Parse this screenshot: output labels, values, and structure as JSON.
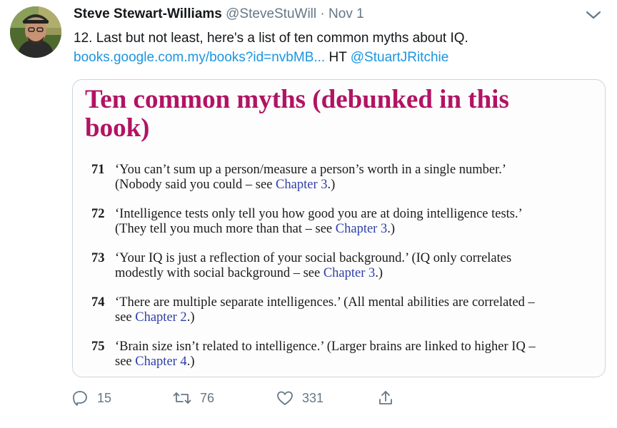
{
  "tweet": {
    "author_name": "Steve Stewart-Williams",
    "handle": "@SteveStuWill",
    "separator": "·",
    "date": "Nov 1",
    "text_line1": "12. Last but not least, here's a list of ten common myths about IQ.",
    "link": "books.google.com.my/books?id=nvbMB...",
    "ht": "HT",
    "mention": "@StuartJRitchie"
  },
  "media": {
    "title_line1": "Ten common myths (debunked in this",
    "title_line2": "book)",
    "myths": [
      {
        "num": "71",
        "line1": "‘You can’t sum up a person/measure a person’s worth in a single number.’",
        "line2_pre": "(Nobody said you could – see ",
        "chapter": "Chapter 3",
        "line2_post": ".)"
      },
      {
        "num": "72",
        "line1": "‘Intelligence tests only tell you how good you are at doing intelligence tests.’",
        "line2_pre": "(They tell you much more than that – see ",
        "chapter": "Chapter 3",
        "line2_post": ".)"
      },
      {
        "num": "73",
        "line1": "‘Your IQ is just a reflection of your social background.’ (IQ only correlates",
        "line2_pre": "modestly with social background – see ",
        "chapter": "Chapter 3",
        "line2_post": ".)"
      },
      {
        "num": "74",
        "line1": "‘There are multiple separate intelligences.’ (All mental abilities are correlated –",
        "line2_pre": "see ",
        "chapter": "Chapter 2",
        "line2_post": ".)"
      },
      {
        "num": "75",
        "line1": "‘Brain size isn’t related to intelligence.’ (Larger brains are linked to higher IQ –",
        "line2_pre": "see ",
        "chapter": "Chapter 4",
        "line2_post": ".)"
      }
    ]
  },
  "actions": {
    "reply_count": "15",
    "retweet_count": "76",
    "like_count": "331"
  },
  "icons": {
    "more": "chevron-down-icon",
    "reply": "reply-icon",
    "retweet": "retweet-icon",
    "like": "heart-icon",
    "share": "share-icon"
  },
  "colors": {
    "link": "#1b95e0",
    "book_title": "#b21363",
    "chapter_link": "#2f3fa8",
    "secondary_text": "#657786"
  }
}
